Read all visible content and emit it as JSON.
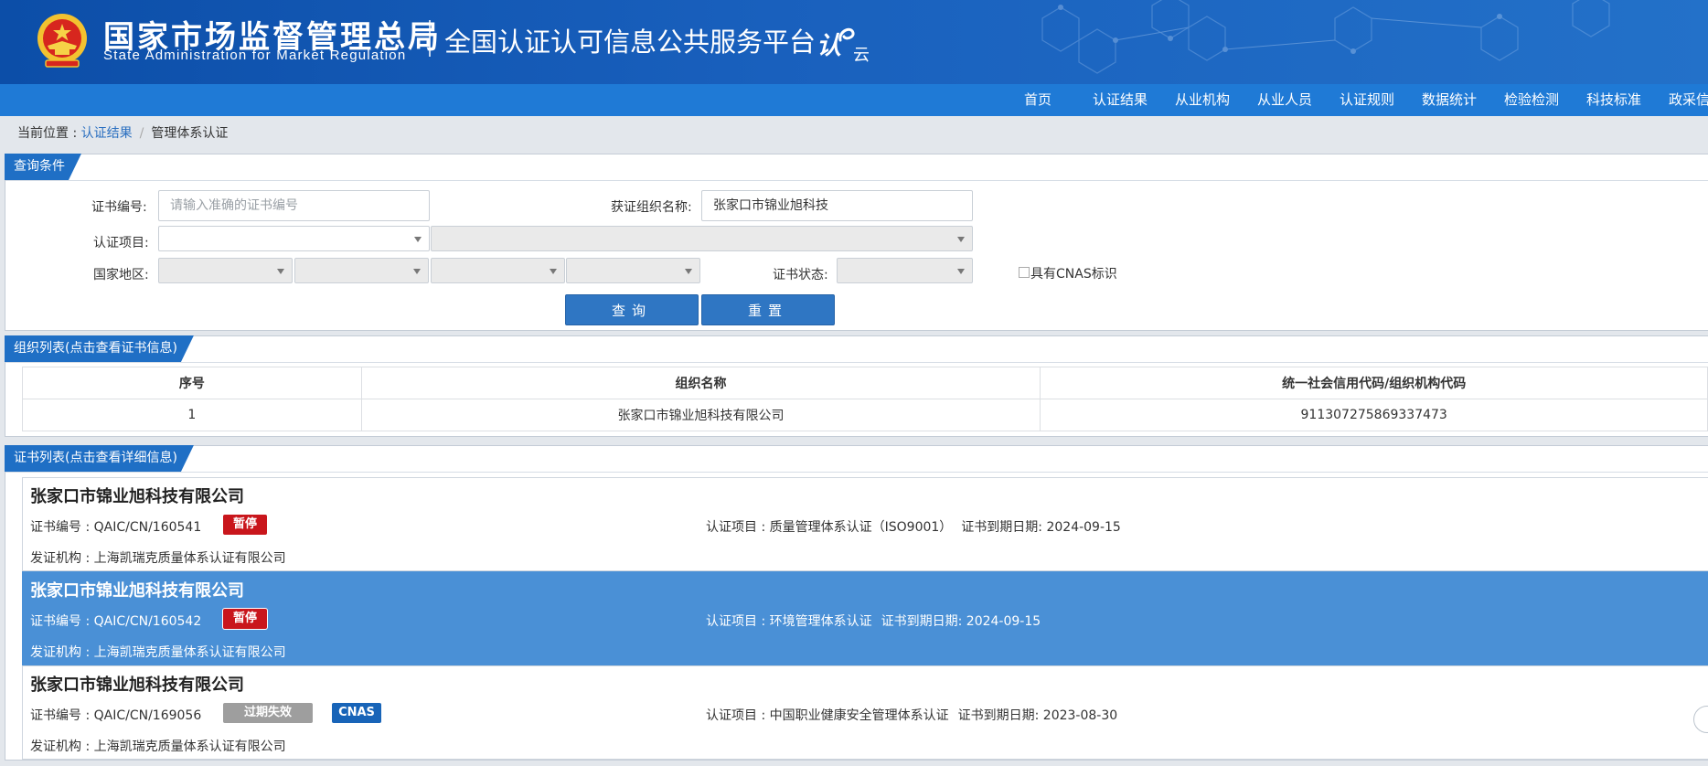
{
  "header": {
    "agency_cn": "国家市场监督管理总局",
    "agency_en": "State Administration  for  Market Regulation",
    "platform": "全国认证认可信息公共服务平台",
    "logo_char": "认",
    "logo_sub": "云",
    "emblem_icon": "national-emblem",
    "brand_color": "#1960bd"
  },
  "nav": {
    "items": [
      "首页",
      "认证结果",
      "从业机构",
      "从业人员",
      "认证规则",
      "数据统计",
      "检验检测",
      "科技标准",
      "政采信"
    ]
  },
  "breadcrumb": {
    "prefix": "当前位置 : ",
    "link": "认证结果",
    "separator": "/",
    "current": "管理体系认证"
  },
  "query": {
    "title": "查询条件",
    "cert_no_label": "证书编号:",
    "cert_no_placeholder": "请输入准确的证书编号",
    "org_name_label": "获证组织名称:",
    "org_name_value": "张家口市锦业旭科技",
    "project_label": "认证项目:",
    "region_label": "国家地区:",
    "status_label": "证书状态:",
    "cnas_checkbox_label": "具有CNAS标识",
    "search_button": "查询",
    "reset_button": "重置"
  },
  "org_list": {
    "title": "组织列表(点击查看证书信息)",
    "columns": [
      "序号",
      "组织名称",
      "统一社会信用代码/组织机构代码"
    ],
    "rows": [
      {
        "index": "1",
        "name": "张家口市锦业旭科技有限公司",
        "code": "911307275869337473"
      }
    ]
  },
  "cert_list": {
    "title": "证书列表(点击查看详细信息)",
    "no_prefix": "证书编号 : ",
    "project_prefix": "认证项目 : ",
    "expiry_prefix": "证书到期日期: ",
    "issuer_prefix": "发证机构 : ",
    "items": [
      {
        "name": "张家口市锦业旭科技有限公司",
        "cert_no": "QAIC/CN/160541",
        "status": "暂停",
        "cnas": "",
        "project": "质量管理体系认证（ISO9001）",
        "expiry": "2024-09-15",
        "issuer": "上海凯瑞克质量体系认证有限公司"
      },
      {
        "name": "张家口市锦业旭科技有限公司",
        "cert_no": "QAIC/CN/160542",
        "status": "暂停",
        "cnas": "",
        "project": "环境管理体系认证",
        "expiry": "2024-09-15",
        "issuer": "上海凯瑞克质量体系认证有限公司"
      },
      {
        "name": "张家口市锦业旭科技有限公司",
        "cert_no": "QAIC/CN/169056",
        "status": "过期失效",
        "cnas": "CNAS",
        "project": "中国职业健康安全管理体系认证",
        "expiry": "2023-08-30",
        "issuer": "上海凯瑞克质量体系认证有限公司"
      }
    ],
    "status_colors": {
      "暂停": "#c9161c",
      "过期失效": "#9e9e9e",
      "CNAS": "#1864b8"
    }
  }
}
